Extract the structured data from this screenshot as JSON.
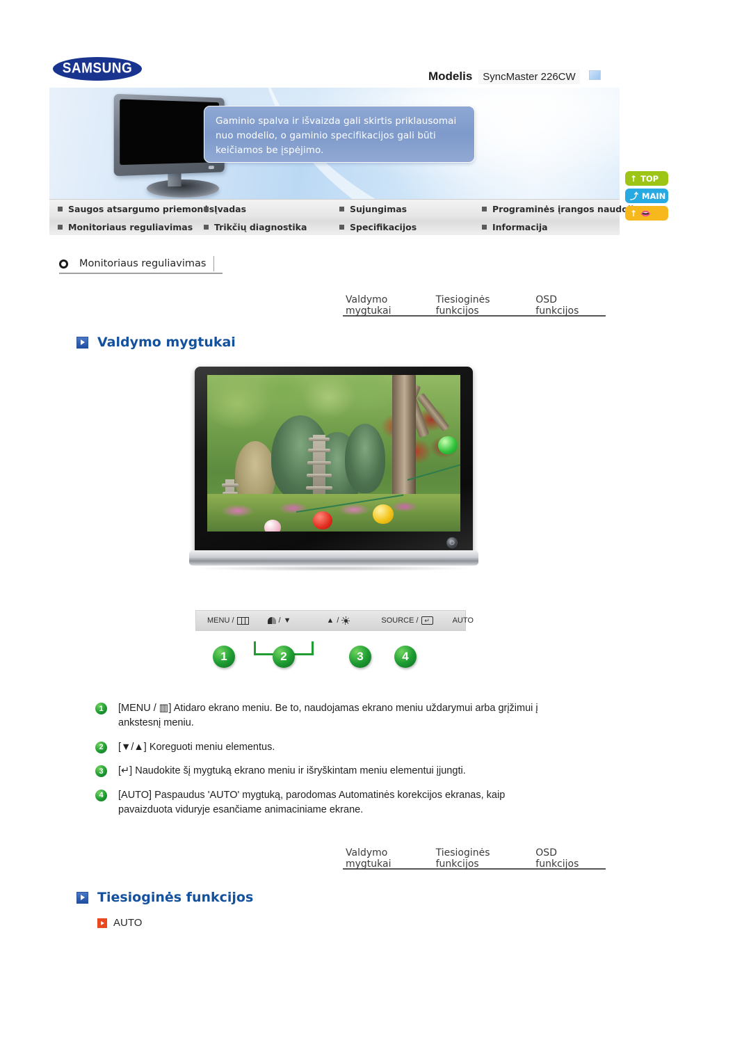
{
  "header": {
    "logo_text": "SAMSUNG",
    "model_label": "Modelis",
    "model_value": "SyncMaster 226CW"
  },
  "banner": {
    "notice": "Gaminio spalva ir išvaizda gali skirtis priklausomai nuo modelio, o gaminio specifikacijos gali būti keičiamos be įspėjimo."
  },
  "nav": {
    "items": [
      {
        "label": "Saugos atsargumo priemonės"
      },
      {
        "label": "Įvadas"
      },
      {
        "label": "Sujungimas"
      },
      {
        "label": "Programinės įrangos naudojimas"
      },
      {
        "label": "Monitoriaus reguliavimas"
      },
      {
        "label": "Trikčių diagnostika"
      },
      {
        "label": "Specifikacijos"
      },
      {
        "label": "Informacija"
      }
    ]
  },
  "side_buttons": [
    {
      "label": "TOP",
      "icon": "arrow-up-icon",
      "color": "#9cc516"
    },
    {
      "label": "MAIN",
      "icon": "arrow-branch-icon",
      "color": "#27a9e1"
    },
    {
      "label": "",
      "icon": "arrow-up-book-icon",
      "color": "#f6b81d"
    }
  ],
  "section": {
    "title": "Monitoriaus reguliavimas"
  },
  "tabs": [
    {
      "label": "Valdymo mygtukai"
    },
    {
      "label": "Tiesioginės funkcijos"
    },
    {
      "label": "OSD funkcijos"
    }
  ],
  "headings": {
    "valdymo_mygtukai": "Valdymo mygtukai",
    "tiesiogines_funkcijos": "Tiesioginės funkcijos",
    "auto": "AUTO"
  },
  "control_strip": {
    "items": [
      {
        "text": "MENU /",
        "icon": "menu-grid-icon"
      },
      {
        "text": "/",
        "icon_left": "brightness-half-icon",
        "icon_right": "triangle-down-icon"
      },
      {
        "text": "/",
        "icon_left": "triangle-up-icon",
        "icon_right": "sun-icon"
      },
      {
        "text": "SOURCE /",
        "icon": "enter-key-icon"
      },
      {
        "text": "AUTO",
        "icon": ""
      }
    ]
  },
  "badges": [
    "1",
    "2",
    "3",
    "4"
  ],
  "descriptions": [
    {
      "num": "1",
      "text": "[MENU / ▥] Atidaro ekrano meniu. Be to, naudojamas ekrano meniu uždarymui arba grįžimui į ankstesnį meniu."
    },
    {
      "num": "2",
      "text": "[▼/▲] Koreguoti meniu elementus."
    },
    {
      "num": "3",
      "text": "[↵] Naudokite šį mygtuką ekrano meniu ir išryškintam meniu elementui įjungti."
    },
    {
      "num": "4",
      "text": "[AUTO] Paspaudus 'AUTO' mygtuką, parodomas Automatinės korekcijos ekranas, kaip pavaizduota viduryje esančiame animaciniame ekrane."
    }
  ],
  "colors": {
    "brand_blue": "#18348e",
    "heading_blue": "#13519e",
    "accent_orange": "#e8491f",
    "badge_green": "#1f9d33"
  }
}
